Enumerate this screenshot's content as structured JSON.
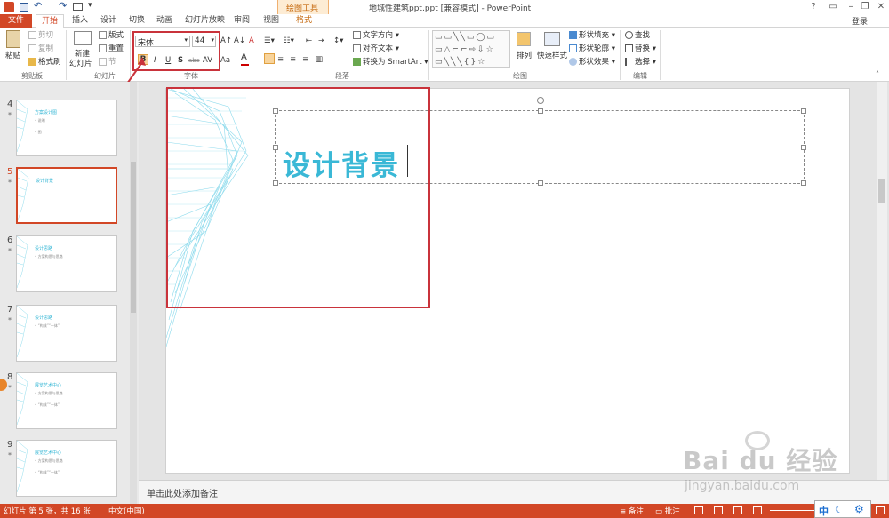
{
  "window": {
    "title": "地城性建筑ppt.ppt [兼容模式] - PowerPoint",
    "tool_context": "绘图工具",
    "login": "登录",
    "controls": [
      "?",
      "▭",
      "–",
      "❐",
      "✕"
    ]
  },
  "tabs": [
    {
      "label": "文件"
    },
    {
      "label": "开始"
    },
    {
      "label": "插入"
    },
    {
      "label": "设计"
    },
    {
      "label": "切换"
    },
    {
      "label": "动画"
    },
    {
      "label": "幻灯片放映"
    },
    {
      "label": "审阅"
    },
    {
      "label": "视图"
    },
    {
      "label": "格式"
    }
  ],
  "ribbon": {
    "clipboard": {
      "group": "剪贴板",
      "paste": "粘贴",
      "cut": "剪切",
      "copy": "复制",
      "format_painter": "格式刷"
    },
    "slides": {
      "group": "幻灯片",
      "new_slide": "新建",
      "new_slide2": "幻灯片",
      "layout": "版式",
      "reset": "重置",
      "section": "节"
    },
    "font": {
      "group": "字体",
      "font_name": "宋体",
      "font_size": "44",
      "bold": "B",
      "italic": "I",
      "underline": "U",
      "shadow": "S",
      "strike": "abc",
      "spacing": "AV",
      "case": "Aa",
      "color": "A"
    },
    "paragraph": {
      "group": "段落",
      "text_direction": "文字方向",
      "align_text": "对齐文本",
      "smartart": "转换为 SmartArt"
    },
    "drawing": {
      "group": "绘图",
      "arrange": "排列",
      "quick_styles": "快速样式",
      "shape_fill": "形状填充",
      "shape_outline": "形状轮廓",
      "shape_effects": "形状效果"
    },
    "editing": {
      "group": "编辑",
      "find": "查找",
      "replace": "替换",
      "select": "选择"
    }
  },
  "thumbnails": [
    {
      "num": "4",
      "title": "方案设计图",
      "bullets": [
        "• 说明",
        "• 图"
      ]
    },
    {
      "num": "5",
      "title": "设计背景",
      "bullets": []
    },
    {
      "num": "6",
      "title": "设计思路",
      "bullets": [
        "• 方案构思与思路"
      ]
    },
    {
      "num": "7",
      "title": "设计思路",
      "bullets": [
        "• “构成”“一体”"
      ]
    },
    {
      "num": "8",
      "title": "展览艺术中心",
      "bullets": [
        "• 方案构思与思路",
        "• “构成”“一体”"
      ]
    },
    {
      "num": "9",
      "title": "展览艺术中心",
      "bullets": [
        "• 方案构思与思路",
        "• “构成”“一体”"
      ]
    }
  ],
  "slide": {
    "title_text": "设计背景",
    "accent": "#3ab8d6"
  },
  "notes": {
    "placeholder": "单击此处添加备注"
  },
  "status": {
    "slide_info": "幻灯片 第 5 张，共 16 张",
    "language": "中文(中国)",
    "notes_btn": "备注",
    "comments_btn": "批注",
    "ime": [
      "中",
      "☾",
      "⚙"
    ]
  },
  "watermark": {
    "brand": "Bai du 经验",
    "url": "jingyan.baidu.com"
  },
  "colors": {
    "accent": "#d24726",
    "highlight": "#c9333b",
    "slide_text": "#3ab8d6"
  }
}
